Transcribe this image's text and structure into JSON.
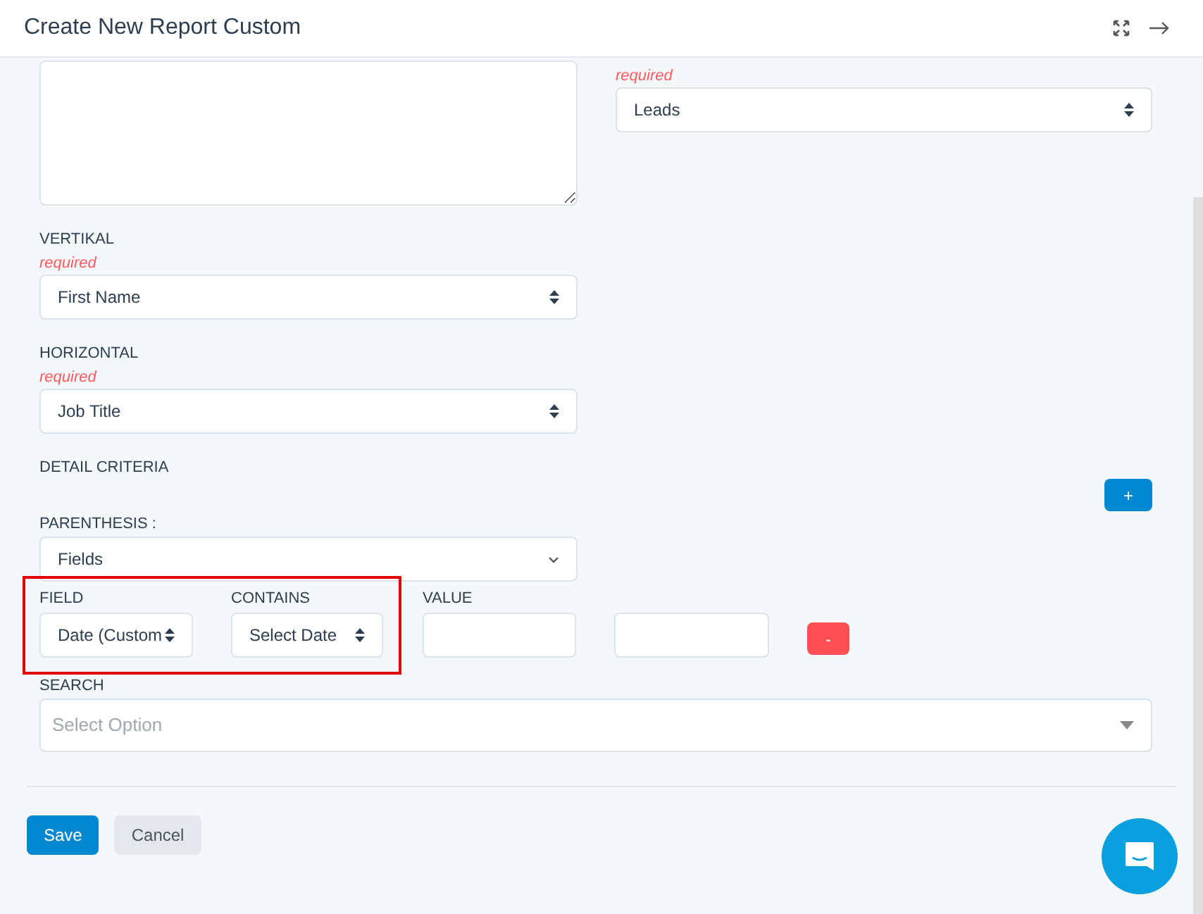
{
  "window": {
    "title": "Create New Report Custom"
  },
  "top": {
    "required": "required",
    "module_select": "Leads"
  },
  "axes": [
    {
      "label": "VERTIKAL",
      "required": "required",
      "value": "First Name"
    },
    {
      "label": "HORIZONTAL",
      "required": "required",
      "value": "Job Title"
    }
  ],
  "detail_criteria": {
    "label": "DETAIL CRITERIA",
    "add_button": "+",
    "parenthesis_label": "PARENTHESIS :",
    "parenthesis_value": "Fields"
  },
  "criteria_row": {
    "field_label": "FIELD",
    "field_value": "Date (Custom",
    "contains_label": "CONTAINS",
    "contains_value": "Select Date",
    "value_label": "VALUE",
    "remove_button": "-"
  },
  "search": {
    "label": "SEARCH",
    "placeholder": "Select Option"
  },
  "buttons": [
    {
      "label": "Save",
      "kind": "primary"
    },
    {
      "label": "Cancel",
      "kind": "secondary"
    }
  ]
}
